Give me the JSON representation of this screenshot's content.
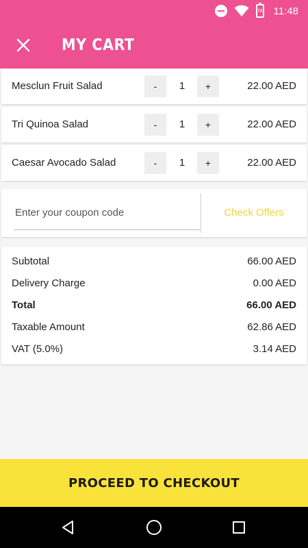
{
  "status_bar": {
    "time": "11:48",
    "battery_level": "78",
    "icons": [
      "do-not-disturb-icon",
      "wifi-icon",
      "battery-icon"
    ]
  },
  "app_bar": {
    "title": "MY CART",
    "close_icon": "close-icon",
    "background": "#ed5191"
  },
  "cart": {
    "items": [
      {
        "name": "Mesclun Fruit Salad",
        "minus": "-",
        "qty": "1",
        "plus": "+",
        "price": "22.00 AED"
      },
      {
        "name": "Tri Quinoa Salad",
        "minus": "-",
        "qty": "1",
        "plus": "+",
        "price": "22.00 AED"
      },
      {
        "name": "Caesar Avocado Salad",
        "minus": "-",
        "qty": "1",
        "plus": "+",
        "price": "22.00 AED"
      }
    ]
  },
  "coupon": {
    "placeholder": "Enter your coupon code",
    "value": "",
    "action_label": "Check Offers",
    "action_color": "#f2d33a"
  },
  "summary": {
    "rows": [
      {
        "label": "Subtotal",
        "value": "66.00 AED"
      },
      {
        "label": "Delivery Charge",
        "value": "0.00 AED"
      },
      {
        "label": "Total",
        "value": "66.00 AED"
      },
      {
        "label": "Taxable Amount",
        "value": "62.86 AED"
      },
      {
        "label": "VAT (5.0%)",
        "value": "3.14 AED"
      }
    ]
  },
  "checkout": {
    "label": "PROCEED TO CHECKOUT",
    "background": "#f9e33b"
  },
  "nav_bar": {
    "icons": [
      "back-icon",
      "home-icon",
      "recents-icon"
    ]
  }
}
